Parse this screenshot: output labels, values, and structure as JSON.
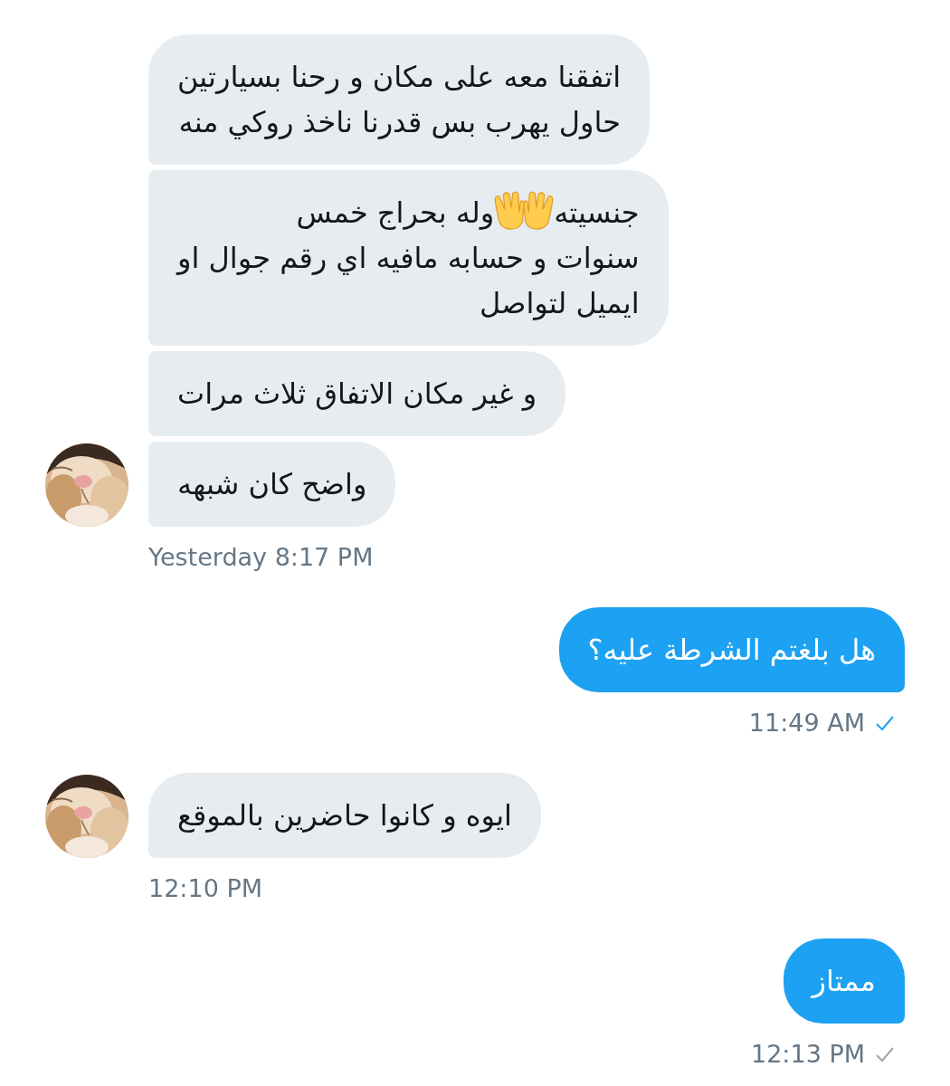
{
  "conversation": [
    {
      "kind": "incoming",
      "messages": [
        {
          "lines": [
            [
              {
                "kind": "text",
                "text": "اتفقنا معه على مكان و رحنا بسيارتين"
              }
            ],
            [
              {
                "kind": "text",
                "text": "حاول يهرب بس قدرنا ناخذ روكي منه"
              }
            ]
          ]
        },
        {
          "lines": [
            [
              {
                "kind": "text",
                "text": "جنسيته"
              },
              {
                "kind": "emoji"
              },
              {
                "kind": "text",
                "text": "وله بحراج خمس"
              }
            ],
            [
              {
                "kind": "text",
                "text": "سنوات و حسابه مافيه اي رقم جوال او"
              }
            ],
            [
              {
                "kind": "text",
                "text": "ايميل لتواصل"
              }
            ]
          ]
        },
        {
          "lines": [
            [
              {
                "kind": "text",
                "text": "و غير مكان الاتفاق ثلاث مرات"
              }
            ]
          ]
        },
        {
          "lines": [
            [
              {
                "kind": "text",
                "text": "واضح كان شبهه"
              }
            ]
          ]
        }
      ],
      "time": "Yesterday 8:17 PM"
    },
    {
      "kind": "outgoing",
      "messages": [
        {
          "lines": [
            [
              {
                "kind": "text",
                "text": "هل بلغتم الشرطة عليه؟"
              }
            ]
          ]
        }
      ],
      "time": "11:49 AM",
      "read": true
    },
    {
      "kind": "incoming",
      "messages": [
        {
          "lines": [
            [
              {
                "kind": "text",
                "text": "ايوه و كانوا حاضرين بالموقع"
              }
            ]
          ]
        }
      ],
      "time": "12:10 PM"
    },
    {
      "kind": "outgoing",
      "messages": [
        {
          "lines": [
            [
              {
                "kind": "text",
                "text": "ممتاز"
              }
            ]
          ]
        }
      ],
      "time": "12:13 PM",
      "read": false
    }
  ]
}
